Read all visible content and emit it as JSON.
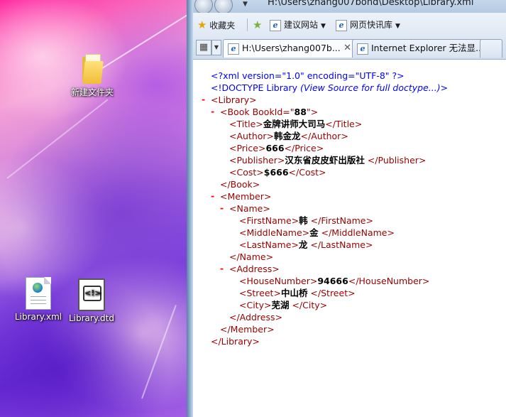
{
  "desktop": {
    "icons": [
      {
        "label": "新建文件夹",
        "type": "folder"
      },
      {
        "label": "Library.xml",
        "type": "xml-file"
      },
      {
        "label": "Library.dtd",
        "type": "dtd-file"
      }
    ]
  },
  "browser": {
    "title": "H:\\Users\\zhang007bond\\Desktop\\Library.xml",
    "favorites_bar": {
      "favorites_label": "收藏夹",
      "suggested_sites": "建议网站",
      "web_slice_gallery": "网页快讯库"
    },
    "tabs": [
      {
        "label": "H:\\Users\\zhang007b...",
        "active": true
      },
      {
        "label": "Internet Explorer 无法显...",
        "active": false
      }
    ],
    "xml": {
      "declaration": "<?xml version=\"1.0\" encoding=\"UTF-8\" ?>",
      "doctype_prefix": "<!DOCTYPE Library ",
      "doctype_note": "(View Source for full doctype...)",
      "doctype_suffix": ">",
      "library_open": "<Library>",
      "book_open_tag": "<Book",
      "book_attr_name": " BookId=\"",
      "book_attr_value": "88",
      "book_attr_end": "\">",
      "title_open": "<Title>",
      "title_value": "金牌讲师大司马",
      "title_close": "</Title>",
      "author_open": "<Author>",
      "author_value": "韩金龙",
      "author_close": "</Author>",
      "price_open": "<Price>",
      "price_value": "666",
      "price_close": "</Price>",
      "publisher_open": "<Publisher>",
      "publisher_value": "汉东省皮皮虾出版社",
      "publisher_close": " </Publisher>",
      "cost_open": "<Cost>",
      "cost_value": "$666",
      "cost_close": "</Cost>",
      "book_close": "</Book>",
      "member_open": "<Member>",
      "name_open": "<Name>",
      "firstname_open": "<FirstName>",
      "firstname_value": "韩",
      "firstname_close": " </FirstName>",
      "middlename_open": "<MiddleName>",
      "middlename_value": "金",
      "middlename_close": " </MiddleName>",
      "lastname_open": "<LastName>",
      "lastname_value": "龙",
      "lastname_close": " </LastName>",
      "name_close": "</Name>",
      "address_open": "<Address>",
      "housenumber_open": "<HouseNumber>",
      "housenumber_value": "94666",
      "housenumber_close": "</HouseNumber>",
      "street_open": "<Street>",
      "street_value": "中山桥",
      "street_close": " </Street>",
      "city_open": "<City>",
      "city_value": "芜湖",
      "city_close": " </City>",
      "address_close": "</Address>",
      "member_close": "</Member>",
      "library_close": "</Library>",
      "collapse_glyph": "-"
    }
  },
  "colors": {
    "xml_tag": "#990000",
    "xml_pi": "#0000ff",
    "xml_collapse": "#ff0000"
  }
}
